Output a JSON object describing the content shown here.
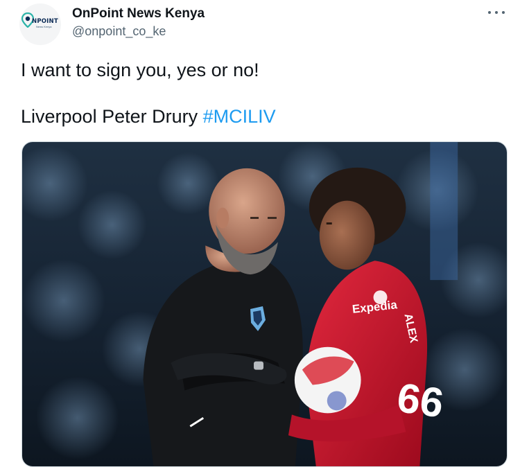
{
  "tweet": {
    "display_name": "OnPoint News Kenya",
    "handle": "@onpoint_co_ke",
    "avatar_brand": "NPOINT",
    "avatar_sub": "News Kenya",
    "line1": "I want to sign you, yes or no!",
    "line2_text": "Liverpool Peter Drury ",
    "hashtag": "#MCILIV",
    "more_icon": "more-horizontal-icon",
    "photo": {
      "sponsor_text": "Expedia",
      "shirt_name": "ALEX",
      "shirt_number": "66"
    }
  },
  "colors": {
    "hashtag": "#1d9bf0",
    "handle": "#536471",
    "liverpool_red": "#c8102e"
  }
}
